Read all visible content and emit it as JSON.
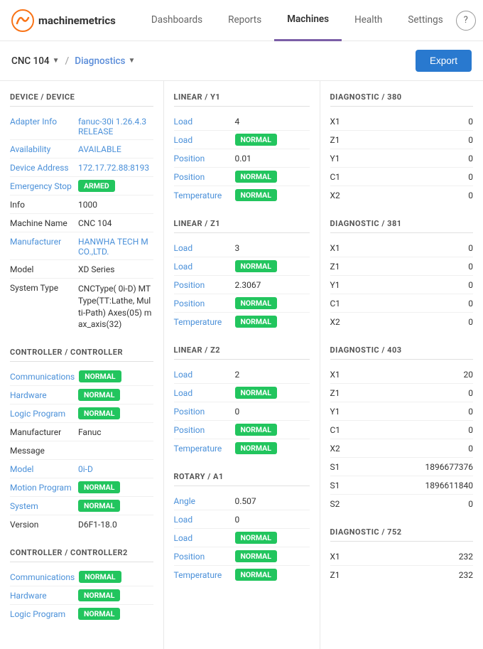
{
  "nav": {
    "logo_text1": "machine",
    "logo_text2": "metrics",
    "links": [
      {
        "label": "Dashboards",
        "active": false
      },
      {
        "label": "Reports",
        "active": false
      },
      {
        "label": "Machines",
        "active": true
      },
      {
        "label": "Health",
        "active": false
      },
      {
        "label": "Settings",
        "active": false
      }
    ]
  },
  "breadcrumb": {
    "machine": "CNC 104",
    "page": "Diagnostics",
    "export_label": "Export"
  },
  "left": {
    "sections": [
      {
        "title": "DEVICE / DEVICE",
        "rows": [
          {
            "label": "Adapter Info",
            "value": "fanuc-30i 1.26.4.3 RELEASE",
            "badge": false,
            "value_color": "#4a90d9"
          },
          {
            "label": "Availability",
            "value": "AVAILABLE",
            "badge": false,
            "value_color": "#4a90d9"
          },
          {
            "label": "Device Address",
            "value": "172.17.72.88:8193",
            "badge": false,
            "value_color": "#4a90d9"
          },
          {
            "label": "Emergency Stop",
            "value": "ARMED",
            "badge": true,
            "badge_type": "armed"
          },
          {
            "label": "Info",
            "value": "1000",
            "badge": false,
            "value_color": "#333"
          },
          {
            "label": "Machine Name",
            "value": "CNC 104",
            "badge": false,
            "value_color": "#333"
          },
          {
            "label": "Manufacturer",
            "value": "HANWHA TECH M CO.,LTD.",
            "badge": false,
            "value_color": "#4a90d9"
          },
          {
            "label": "Model",
            "value": "XD Series",
            "badge": false,
            "value_color": "#333"
          },
          {
            "label": "System Type",
            "value": "CNCType( 0i-D) MTType(TT:Lathe, Multi-Path) Axes(05) max_axis(32)",
            "badge": false,
            "value_color": "#333",
            "multiline": true
          }
        ]
      },
      {
        "title": "CONTROLLER / CONTROLLER",
        "rows": [
          {
            "label": "Communications",
            "value": "NORMAL",
            "badge": true,
            "badge_type": "normal"
          },
          {
            "label": "Hardware",
            "value": "NORMAL",
            "badge": true,
            "badge_type": "normal"
          },
          {
            "label": "Logic Program",
            "value": "NORMAL",
            "badge": true,
            "badge_type": "normal"
          },
          {
            "label": "Manufacturer",
            "value": "Fanuc",
            "badge": false,
            "value_color": "#333"
          },
          {
            "label": "Message",
            "value": "",
            "badge": false,
            "value_color": "#333"
          },
          {
            "label": "Model",
            "value": "0i-D",
            "badge": false,
            "value_color": "#4a90d9"
          },
          {
            "label": "Motion Program",
            "value": "NORMAL",
            "badge": true,
            "badge_type": "normal"
          },
          {
            "label": "System",
            "value": "NORMAL",
            "badge": true,
            "badge_type": "normal"
          },
          {
            "label": "Version",
            "value": "D6F1-18.0",
            "badge": false,
            "value_color": "#333"
          }
        ]
      },
      {
        "title": "CONTROLLER / CONTROLLER2",
        "rows": [
          {
            "label": "Communications",
            "value": "NORMAL",
            "badge": true,
            "badge_type": "normal"
          },
          {
            "label": "Hardware",
            "value": "NORMAL",
            "badge": true,
            "badge_type": "normal"
          },
          {
            "label": "Logic Program",
            "value": "NORMAL",
            "badge": true,
            "badge_type": "normal"
          }
        ]
      }
    ]
  },
  "mid": {
    "sections": [
      {
        "title": "LINEAR / Y1",
        "rows": [
          {
            "label": "Load",
            "value": "4",
            "badge": false
          },
          {
            "label": "Load",
            "value": "NORMAL",
            "badge": true
          },
          {
            "label": "Position",
            "value": "0.01",
            "badge": false
          },
          {
            "label": "Position",
            "value": "NORMAL",
            "badge": true
          },
          {
            "label": "Temperature",
            "value": "NORMAL",
            "badge": true
          }
        ]
      },
      {
        "title": "LINEAR / Z1",
        "rows": [
          {
            "label": "Load",
            "value": "3",
            "badge": false
          },
          {
            "label": "Load",
            "value": "NORMAL",
            "badge": true
          },
          {
            "label": "Position",
            "value": "2.3067",
            "badge": false
          },
          {
            "label": "Position",
            "value": "NORMAL",
            "badge": true
          },
          {
            "label": "Temperature",
            "value": "NORMAL",
            "badge": true
          }
        ]
      },
      {
        "title": "LINEAR / Z2",
        "rows": [
          {
            "label": "Load",
            "value": "2",
            "badge": false
          },
          {
            "label": "Load",
            "value": "NORMAL",
            "badge": true
          },
          {
            "label": "Position",
            "value": "0",
            "badge": false
          },
          {
            "label": "Position",
            "value": "NORMAL",
            "badge": true
          },
          {
            "label": "Temperature",
            "value": "NORMAL",
            "badge": true
          }
        ]
      },
      {
        "title": "ROTARY / A1",
        "rows": [
          {
            "label": "Angle",
            "value": "0.507",
            "badge": false
          },
          {
            "label": "Load",
            "value": "0",
            "badge": false
          },
          {
            "label": "Load",
            "value": "NORMAL",
            "badge": true
          },
          {
            "label": "Position",
            "value": "NORMAL",
            "badge": true
          },
          {
            "label": "Temperature",
            "value": "NORMAL",
            "badge": true
          }
        ]
      }
    ]
  },
  "right": {
    "sections": [
      {
        "title": "DIAGNOSTIC / 380",
        "rows": [
          {
            "label": "X1",
            "value": "0"
          },
          {
            "label": "Z1",
            "value": "0"
          },
          {
            "label": "Y1",
            "value": "0"
          },
          {
            "label": "C1",
            "value": "0"
          },
          {
            "label": "X2",
            "value": "0"
          }
        ]
      },
      {
        "title": "DIAGNOSTIC / 381",
        "rows": [
          {
            "label": "X1",
            "value": "0"
          },
          {
            "label": "Z1",
            "value": "0"
          },
          {
            "label": "Y1",
            "value": "0"
          },
          {
            "label": "C1",
            "value": "0"
          },
          {
            "label": "X2",
            "value": "0"
          }
        ]
      },
      {
        "title": "DIAGNOSTIC / 403",
        "rows": [
          {
            "label": "X1",
            "value": "20"
          },
          {
            "label": "Z1",
            "value": "0"
          },
          {
            "label": "Y1",
            "value": "0"
          },
          {
            "label": "C1",
            "value": "0"
          },
          {
            "label": "X2",
            "value": "0"
          },
          {
            "label": "S1",
            "value": "1896677376"
          },
          {
            "label": "S1",
            "value": "1896611840"
          },
          {
            "label": "S2",
            "value": "0"
          }
        ]
      },
      {
        "title": "DIAGNOSTIC / 752",
        "rows": [
          {
            "label": "X1",
            "value": "232"
          },
          {
            "label": "Z1",
            "value": "232"
          }
        ]
      }
    ]
  }
}
